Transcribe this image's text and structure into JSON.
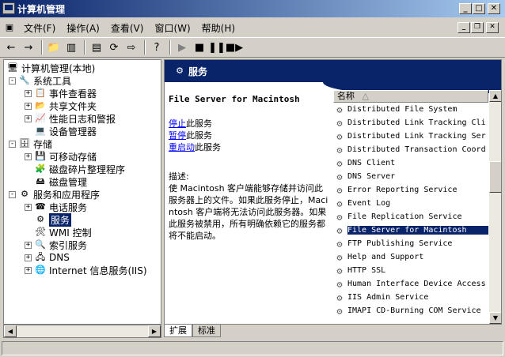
{
  "window": {
    "title": "计算机管理"
  },
  "caption_buttons": {
    "minimize": "_",
    "maximize": "□",
    "close": "✕"
  },
  "menu": [
    "文件(F)",
    "操作(A)",
    "查看(V)",
    "窗口(W)",
    "帮助(H)"
  ],
  "tree": {
    "root": "计算机管理(本地)",
    "items": [
      {
        "label": "系统工具",
        "exp": "-"
      },
      {
        "label": "事件查看器",
        "exp": "+"
      },
      {
        "label": "共享文件夹",
        "exp": "+"
      },
      {
        "label": "性能日志和警报",
        "exp": "+"
      },
      {
        "label": "设备管理器",
        "exp": ""
      },
      {
        "label": "存储",
        "exp": "-"
      },
      {
        "label": "可移动存储",
        "exp": "+"
      },
      {
        "label": "磁盘碎片整理程序",
        "exp": ""
      },
      {
        "label": "磁盘管理",
        "exp": ""
      },
      {
        "label": "服务和应用程序",
        "exp": "-"
      },
      {
        "label": "电话服务",
        "exp": "+"
      },
      {
        "label": "服务",
        "exp": ""
      },
      {
        "label": "WMI 控制",
        "exp": ""
      },
      {
        "label": "索引服务",
        "exp": "+"
      },
      {
        "label": "DNS",
        "exp": "+"
      },
      {
        "label": "Internet 信息服务(IIS)",
        "exp": "+"
      }
    ]
  },
  "panel": {
    "header": "服务",
    "service_name": "File Server for Macintosh",
    "link_stop": "停止",
    "link_stop_suffix": "此服务",
    "link_pause": "暂停",
    "link_pause_suffix": "此服务",
    "link_restart": "重启动",
    "link_restart_suffix": "此服务",
    "desc_label": "描述:",
    "desc_text": "使 Macintosh 客户端能够存储并访问此服务器上的文件。如果此服务停止，Macintosh 客户端将无法访问此服务器。如果此服务被禁用，所有明确依赖它的服务都将不能启动。"
  },
  "list": {
    "column": "名称",
    "sort_arrow": "△",
    "rows": [
      "Distributed File System",
      "Distributed Link Tracking Cli",
      "Distributed Link Tracking Ser",
      "Distributed Transaction Coord",
      "DNS Client",
      "DNS Server",
      "Error Reporting Service",
      "Event Log",
      "File Replication Service",
      "File Server for Macintosh",
      "FTP Publishing Service",
      "Help and Support",
      "HTTP SSL",
      "Human Interface Device Access",
      "IIS Admin Service",
      "IMAPI CD-Burning COM Service"
    ],
    "selected": "File Server for Macintosh"
  },
  "tabs": [
    "扩展",
    "标准"
  ],
  "colors": {
    "title_active": "#0a246a",
    "link": "#0000ff",
    "selection": "#0a246a"
  },
  "icons": {
    "tree": [
      "computer-icon",
      "tools-icon",
      "event-icon",
      "share-icon",
      "perf-icon",
      "device-icon",
      "storage-icon",
      "removable-icon",
      "defrag-icon",
      "disk-icon",
      "apps-icon",
      "phone-icon",
      "service-icon",
      "wmi-icon",
      "index-icon",
      "dns-icon",
      "iis-icon"
    ]
  }
}
